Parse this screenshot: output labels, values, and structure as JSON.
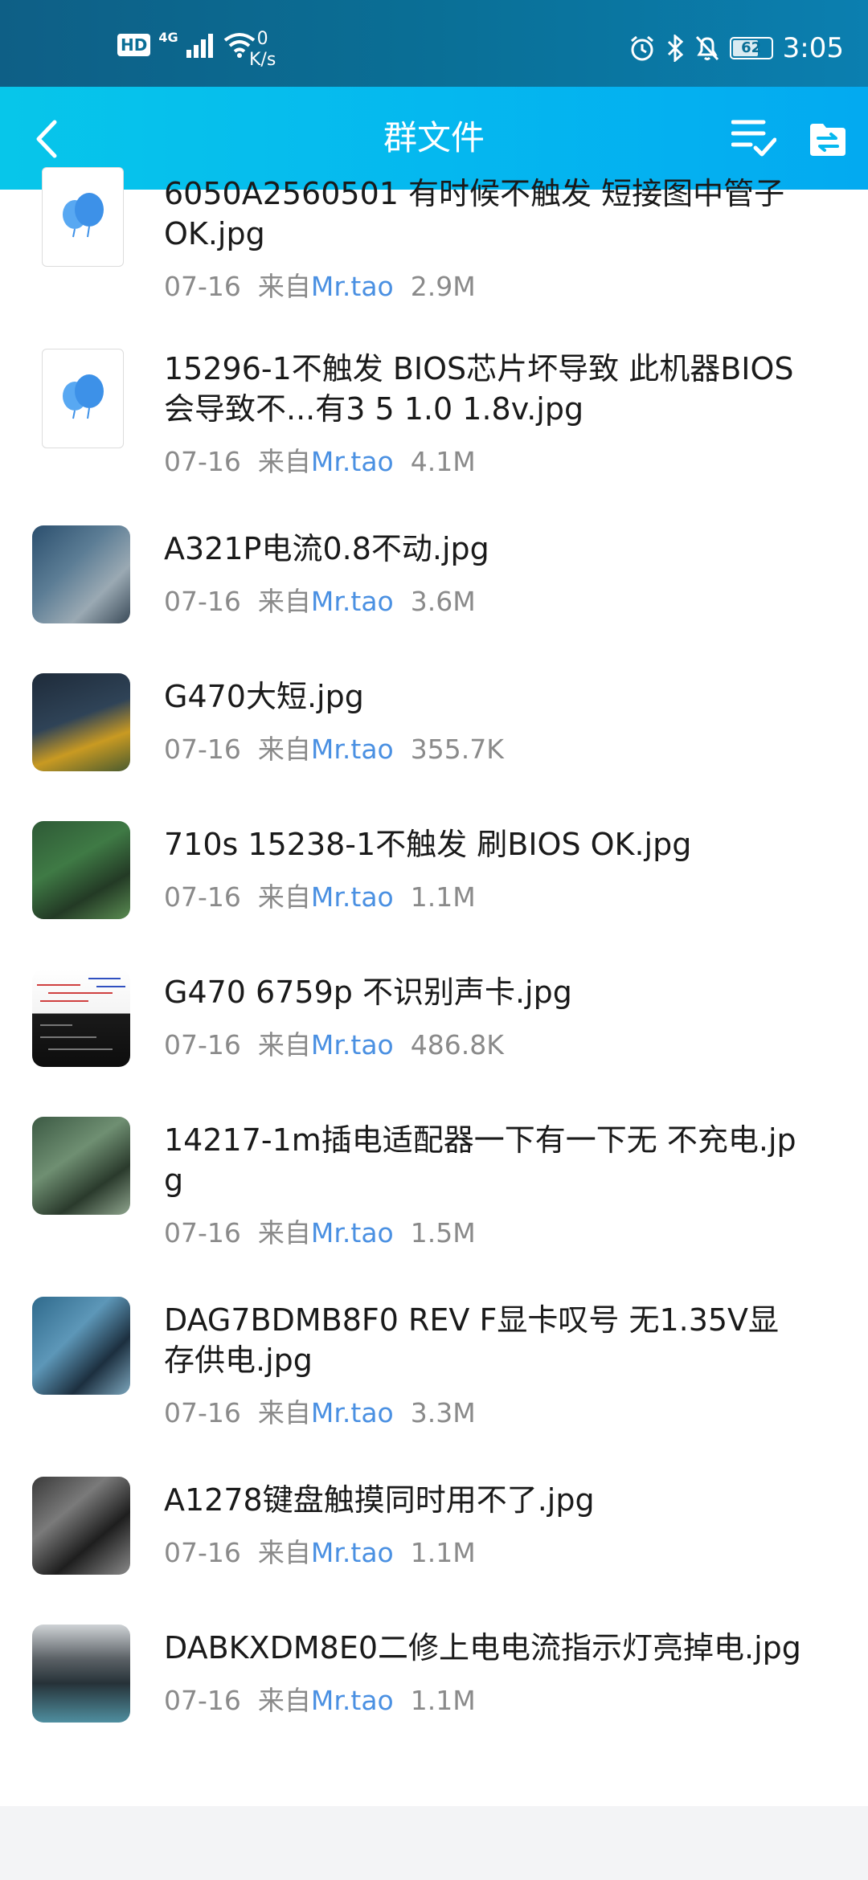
{
  "status": {
    "hd": "HD",
    "network": "4G",
    "speed_value": "0",
    "speed_unit": "K/s",
    "battery": "62",
    "time": "3:05"
  },
  "header": {
    "title": "群文件"
  },
  "files": [
    {
      "name": "6050A2560501 有时候不触发 短接图中管子OK.jpg",
      "date": "07-16",
      "from_prefix": "来自",
      "sender": "Mr.tao",
      "size": "2.9M",
      "thumb": "balloon-icon"
    },
    {
      "name": "15296-1不触发 BIOS芯片坏导致 此机器BIOS会导致不...有3 5 1.0 1.8v.jpg",
      "date": "07-16",
      "from_prefix": "来自",
      "sender": "Mr.tao",
      "size": "4.1M",
      "thumb": "balloon-icon"
    },
    {
      "name": "A321P电流0.8不动.jpg",
      "date": "07-16",
      "from_prefix": "来自",
      "sender": "Mr.tao",
      "size": "3.6M",
      "thumb": "photo"
    },
    {
      "name": "G470大短.jpg",
      "date": "07-16",
      "from_prefix": "来自",
      "sender": "Mr.tao",
      "size": "355.7K",
      "thumb": "photo"
    },
    {
      "name": "710s 15238-1不触发 刷BIOS OK.jpg",
      "date": "07-16",
      "from_prefix": "来自",
      "sender": "Mr.tao",
      "size": "1.1M",
      "thumb": "photo"
    },
    {
      "name": "G470 6759p 不识别声卡.jpg",
      "date": "07-16",
      "from_prefix": "来自",
      "sender": "Mr.tao",
      "size": "486.8K",
      "thumb": "schematic"
    },
    {
      "name": "14217-1m插电适配器一下有一下无 不充电.jpg",
      "date": "07-16",
      "from_prefix": "来自",
      "sender": "Mr.tao",
      "size": "1.5M",
      "thumb": "photo"
    },
    {
      "name": "DAG7BDMB8F0 REV F显卡叹号 无1.35V显存供电.jpg",
      "date": "07-16",
      "from_prefix": "来自",
      "sender": "Mr.tao",
      "size": "3.3M",
      "thumb": "photo"
    },
    {
      "name": "A1278键盘触摸同时用不了.jpg",
      "date": "07-16",
      "from_prefix": "来自",
      "sender": "Mr.tao",
      "size": "1.1M",
      "thumb": "photo"
    },
    {
      "name": "DABKXDM8E0二修上电电流指示灯亮掉电.jpg",
      "date": "07-16",
      "from_prefix": "来自",
      "sender": "Mr.tao",
      "size": "1.1M",
      "thumb": "photo"
    }
  ],
  "colors": {
    "accent_link": "#4a90e2",
    "header_start": "#07c6ea",
    "header_end": "#03aaf0"
  }
}
